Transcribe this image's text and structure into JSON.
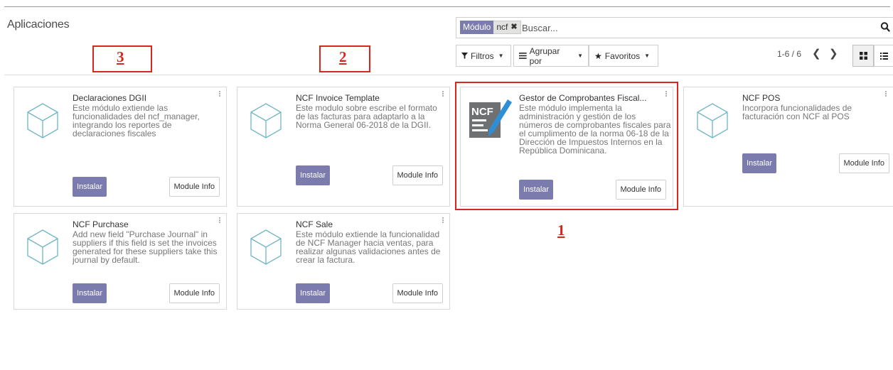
{
  "page": {
    "title": "Aplicaciones"
  },
  "search": {
    "facet_label": "Módulo",
    "facet_value": "ncf",
    "facet_remove": "✖",
    "placeholder": "Buscar..."
  },
  "toolbar": {
    "filters_label": "Filtros",
    "group_label": "Agrupar por",
    "favorites_label": "Favoritos"
  },
  "pager": {
    "value": "1-6 / 6",
    "prev": "❮",
    "next": "❯"
  },
  "modules": [
    {
      "title": "Declaraciones DGII",
      "description": "Este módulo extiende las funcionalidades del ncf_manager, integrando los reportes de declaraciones fiscales",
      "install_label": "Instalar",
      "info_label": "Module Info",
      "icon": "cube-icon"
    },
    {
      "title": "NCF Invoice Template",
      "description": "Este modulo sobre escribe el formato de las facturas para adaptarlo a la Norma General 06-2018 de la DGII.",
      "install_label": "Instalar",
      "info_label": "Module Info",
      "icon": "cube-icon"
    },
    {
      "title": "Gestor de Comprobantes Fiscal...",
      "description": "Este módulo implementa la administración y gestión de los números de comprobantes fiscales para el cumplimento de la norma 06-18 de la Dirección de Impuestos Internos en la República Dominicana.",
      "install_label": "Instalar",
      "info_label": "Module Info",
      "icon": "ncf-document-icon",
      "icon_text": "NCF"
    },
    {
      "title": "NCF POS",
      "description": "Incorpora funcionalidades de facturación con NCF al POS",
      "install_label": "Instalar",
      "info_label": "Module Info",
      "icon": "cube-icon"
    },
    {
      "title": "NCF Purchase",
      "description": "Add new field \"Purchase Journal\" in suppliers if this field is set the invoices generated for these suppliers take this journal by default.",
      "install_label": "Instalar",
      "info_label": "Module Info",
      "icon": "cube-icon"
    },
    {
      "title": "NCF Sale",
      "description": "Este módulo extiende la funcionalidad de NCF Manager hacia ventas, para realizar algunas validaciones antes de crear la factura.",
      "install_label": "Instalar",
      "info_label": "Module Info",
      "icon": "cube-icon"
    }
  ],
  "annotations": [
    "1",
    "2",
    "3"
  ],
  "colors": {
    "accent": "#7c7bad",
    "annotation": "#d6281f",
    "ncf_logo_gray": "#6e7072",
    "pen_blue": "#2e8fd6"
  }
}
